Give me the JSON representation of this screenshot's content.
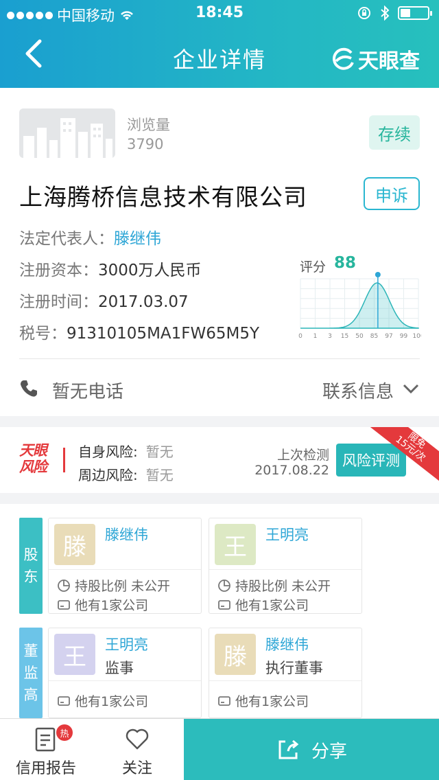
{
  "status_bar": {
    "carrier": "中国移动",
    "time": "18:45"
  },
  "header": {
    "title": "企业详情",
    "logo_text": "天眼查"
  },
  "company": {
    "views_label": "浏览量",
    "views": "3790",
    "status": "存续",
    "name": "上海腾桥信息技术有限公司",
    "appeal_label": "申诉",
    "legal_rep_label": "法定代表人：",
    "legal_rep": "滕继伟",
    "capital_label": "注册资本：",
    "capital": "3000万人民币",
    "reg_date_label": "注册时间：",
    "reg_date": "2017.03.07",
    "tax_label": "税号：",
    "tax_id": "91310105MA1FW65M5Y",
    "score_label": "评分",
    "score": "88",
    "phone": "暂无电话",
    "contact_label": "联系信息"
  },
  "chart_data": {
    "type": "area",
    "x_ticks": [
      "0",
      "1",
      "3",
      "15",
      "50",
      "85",
      "97",
      "99",
      "100"
    ],
    "marker": 88
  },
  "risk": {
    "logo_line1": "天眼",
    "logo_line2": "风险",
    "self_label": "自身风险:",
    "self_value": "暂无",
    "around_label": "周边风险:",
    "around_value": "暂无",
    "last_check_label": "上次检测",
    "last_check_date": "2017.08.22",
    "button": "风险评测",
    "ribbon_line1": "限免",
    "ribbon_line2": "15元/次"
  },
  "shareholders": {
    "tab": "股东",
    "items": [
      {
        "avatar": "滕",
        "name": "滕继伟",
        "ratio": "持股比例 未公开",
        "companies": "他有1家公司"
      },
      {
        "avatar": "王",
        "name": "王明亮",
        "ratio": "持股比例 未公开",
        "companies": "他有1家公司"
      }
    ]
  },
  "executives": {
    "tab": "董监高",
    "items": [
      {
        "avatar": "王",
        "name": "王明亮",
        "role": "监事",
        "companies": "他有1家公司"
      },
      {
        "avatar": "滕",
        "name": "滕继伟",
        "role": "执行董事",
        "companies": "他有1家公司"
      }
    ]
  },
  "bottom": {
    "report": "信用报告",
    "hot": "热",
    "follow": "关注",
    "share": "分享"
  },
  "colors": {
    "accent": "#29b6b8",
    "link": "#2ea6d6",
    "risk_red": "#e4393c"
  }
}
